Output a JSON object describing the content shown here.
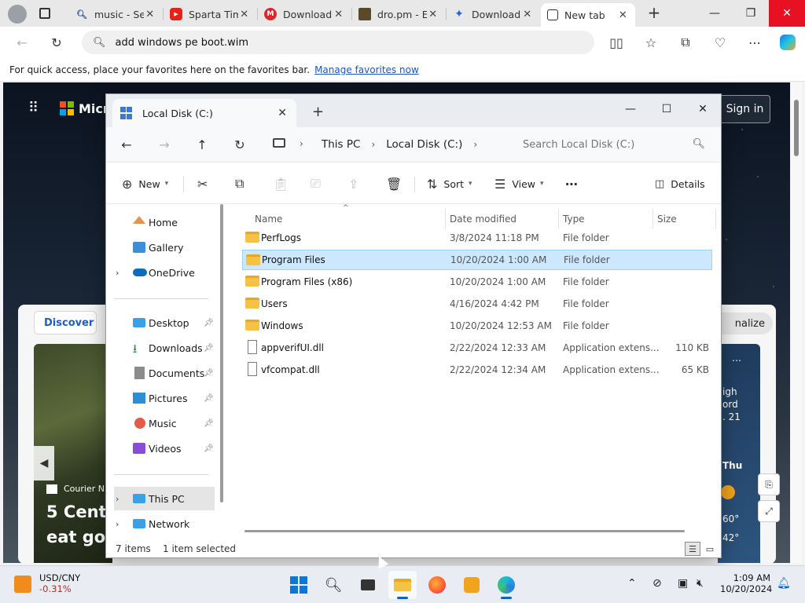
{
  "browser": {
    "tabs": [
      {
        "label": "music - Se",
        "icon": "search-icon"
      },
      {
        "label": "Sparta Tim",
        "icon": "youtube-icon"
      },
      {
        "label": "Download",
        "icon": "mega-icon"
      },
      {
        "label": "dro.pm - E",
        "icon": "dropm-icon"
      },
      {
        "label": "Download",
        "icon": "download-site-icon"
      },
      {
        "label": "New tab",
        "icon": "newtab-icon"
      }
    ],
    "address": "add windows pe boot.wim",
    "favorites_hint": "For quick access, place your favorites here on the favorites bar.",
    "favorites_link": "Manage favorites now"
  },
  "ntp": {
    "brand": "Micr",
    "signin": "Sign in",
    "discover": "Discover",
    "personalize": "nalize",
    "hero_source": "Courier N",
    "hero_title_1": "5 Centr",
    "hero_title_2": "eat goo",
    "weather": {
      "l1": "igh",
      "l2": "ord",
      "l3": ". 21",
      "day": "Thu",
      "t1": "60°",
      "t2": "42°"
    }
  },
  "explorer": {
    "tab_title": "Local Disk (C:)",
    "breadcrumb": [
      "This PC",
      "Local Disk (C:)"
    ],
    "search_placeholder": "Search Local Disk (C:)",
    "commands": {
      "new": "New",
      "sort": "Sort",
      "view": "View",
      "details": "Details"
    },
    "nav": {
      "home": "Home",
      "gallery": "Gallery",
      "onedrive": "OneDrive",
      "desktop": "Desktop",
      "downloads": "Downloads",
      "documents": "Documents",
      "pictures": "Pictures",
      "music": "Music",
      "videos": "Videos",
      "thispc": "This PC",
      "network": "Network"
    },
    "columns": {
      "name": "Name",
      "date": "Date modified",
      "type": "Type",
      "size": "Size"
    },
    "files": [
      {
        "name": "PerfLogs",
        "date": "3/8/2024 11:18 PM",
        "type": "File folder",
        "size": "",
        "kind": "folder"
      },
      {
        "name": "Program Files",
        "date": "10/20/2024 1:00 AM",
        "type": "File folder",
        "size": "",
        "kind": "folder"
      },
      {
        "name": "Program Files (x86)",
        "date": "10/20/2024 1:00 AM",
        "type": "File folder",
        "size": "",
        "kind": "folder"
      },
      {
        "name": "Users",
        "date": "4/16/2024 4:42 PM",
        "type": "File folder",
        "size": "",
        "kind": "folder"
      },
      {
        "name": "Windows",
        "date": "10/20/2024 12:53 AM",
        "type": "File folder",
        "size": "",
        "kind": "folder"
      },
      {
        "name": "appverifUI.dll",
        "date": "2/22/2024 12:33 AM",
        "type": "Application extens...",
        "size": "110 KB",
        "kind": "file"
      },
      {
        "name": "vfcompat.dll",
        "date": "2/22/2024 12:34 AM",
        "type": "Application extens...",
        "size": "65 KB",
        "kind": "file"
      }
    ],
    "status": {
      "items": "7 items",
      "selected": "1 item selected"
    }
  },
  "taskbar": {
    "stock_name": "USD/CNY",
    "stock_change": "-0.31%",
    "time": "1:09 AM",
    "date": "10/20/2024"
  },
  "colors": {
    "accent": "#0a64c2",
    "selection": "#cce8ff",
    "close_red": "#e81123",
    "folder": "#f5c146"
  }
}
